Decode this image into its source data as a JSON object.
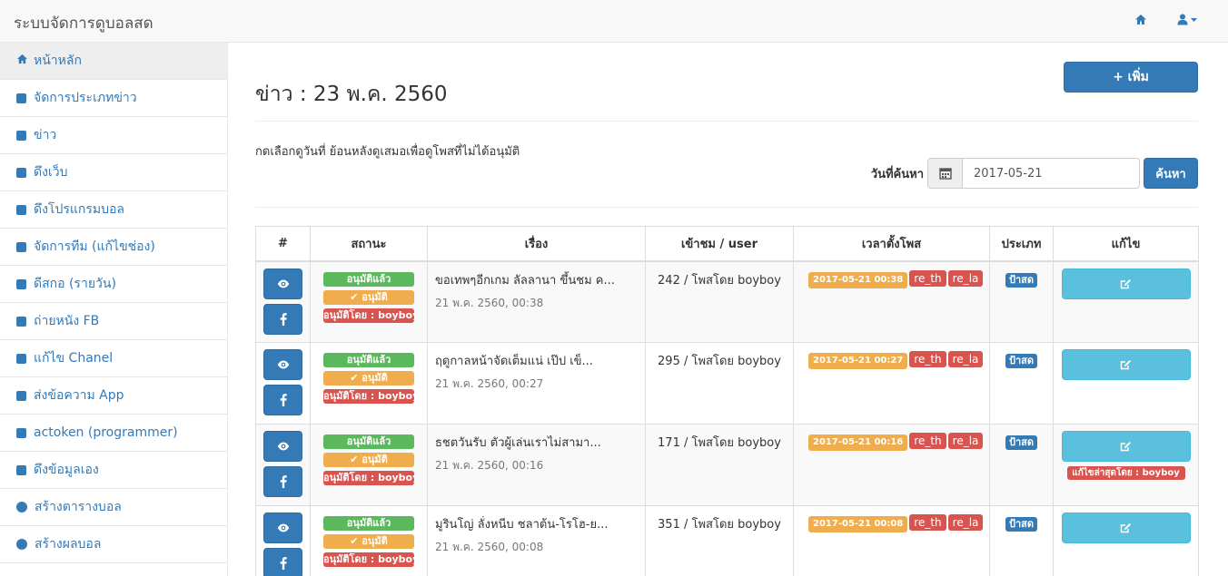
{
  "app": {
    "title": "ระบบจัดการดูบอลสด"
  },
  "sidebar": {
    "items": [
      {
        "label": "หน้าหลัก",
        "icon": "home-icon"
      },
      {
        "label": "จัดการประเภทข่าว",
        "icon": "square-icon"
      },
      {
        "label": "ข่าว",
        "icon": "square-icon"
      },
      {
        "label": "ดึงเว็บ",
        "icon": "square-icon"
      },
      {
        "label": "ดึงโปรแกรมบอล",
        "icon": "square-icon"
      },
      {
        "label": "จัดการทีม (แก้ไขช่อง)",
        "icon": "square-icon"
      },
      {
        "label": "ดีสกอ (รายวัน)",
        "icon": "square-icon"
      },
      {
        "label": "ถ่ายหนัง FB",
        "icon": "square-icon"
      },
      {
        "label": "แก้ไข Chanel",
        "icon": "square-icon"
      },
      {
        "label": "ส่งข้อความ App",
        "icon": "square-icon"
      },
      {
        "label": "actoken (programmer)",
        "icon": "square-icon"
      },
      {
        "label": "ดึงข้อมูลเอง",
        "icon": "square-icon"
      },
      {
        "label": "สร้างตารางบอล",
        "icon": "circle-icon"
      },
      {
        "label": "สร้างผลบอล",
        "icon": "circle-icon"
      }
    ]
  },
  "main": {
    "title": "ข่าว : 23 พ.ค. 2560",
    "add_label": "+ เพิ่ม",
    "hint": "กดเลือกดูวันที่ ย้อนหลังดูเสมอเพื่อดูโพสที่ไม่ได้อนุมัติ",
    "search_label": "วันที่ค้นหา",
    "search_date": "2017-05-21",
    "search_button": "ค้นหา"
  },
  "table": {
    "headers": [
      "#",
      "สถานะ",
      "เรื่อง",
      "เข้าชม / user",
      "เวลาตั้งโพส",
      "ประเภท",
      "แก้ไข"
    ],
    "rows": [
      {
        "status": [
          "อนุมัติแล้ว",
          "✔ อนุมัติ",
          "อนุมัติโดย : boyboy"
        ],
        "title": "ขอเทพๆอีกเกม ลัลลานา ขึ้นชม ค...",
        "date": "21 พ.ค. 2560, 00:38",
        "views": "242 / โพสโดย boyboy",
        "time": "2017-05-21 00:38",
        "tags": [
          "re_th",
          "re_la"
        ],
        "type": "ป้าสด",
        "edit_note": ""
      },
      {
        "status": [
          "อนุมัติแล้ว",
          "✔ อนุมัติ",
          "อนุมัติโดย : boyboy"
        ],
        "title": "ฤดูกาลหน้าจัดเต็มแน่ เป๊ป เข็...",
        "date": "21 พ.ค. 2560, 00:27",
        "views": "295 / โพสโดย boyboy",
        "time": "2017-05-21 00:27",
        "tags": [
          "re_th",
          "re_la"
        ],
        "type": "ป้าสด",
        "edit_note": ""
      },
      {
        "status": [
          "อนุมัติแล้ว",
          "✔ อนุมัติ",
          "อนุมัติโดย : boyboy"
        ],
        "title": "ธชตวันรับ ตัวผู้เล่นเราไม่สามา...",
        "date": "21 พ.ค. 2560, 00:16",
        "views": "171 / โพสโดย boyboy",
        "time": "2017-05-21 00:16",
        "tags": [
          "re_th",
          "re_la"
        ],
        "type": "ป้าสด",
        "edit_note": "แก้ไขล่าสุดโดย : boyboy"
      },
      {
        "status": [
          "อนุมัติแล้ว",
          "✔ อนุมัติ",
          "อนุมัติโดย : boyboy"
        ],
        "title": "มูรินโญ่ ลั่งหนีบ ชลาต้น-โรโฮ-ย...",
        "date": "21 พ.ค. 2560, 00:08",
        "views": "351 / โพสโดย boyboy",
        "time": "2017-05-21 00:08",
        "tags": [
          "re_th",
          "re_la"
        ],
        "type": "ป้าสด",
        "edit_note": ""
      }
    ]
  },
  "colors": {
    "primary": "#337ab7",
    "success": "#5cb85c",
    "warning": "#f0ad4e",
    "danger": "#d9534f",
    "info": "#5bc0de"
  }
}
